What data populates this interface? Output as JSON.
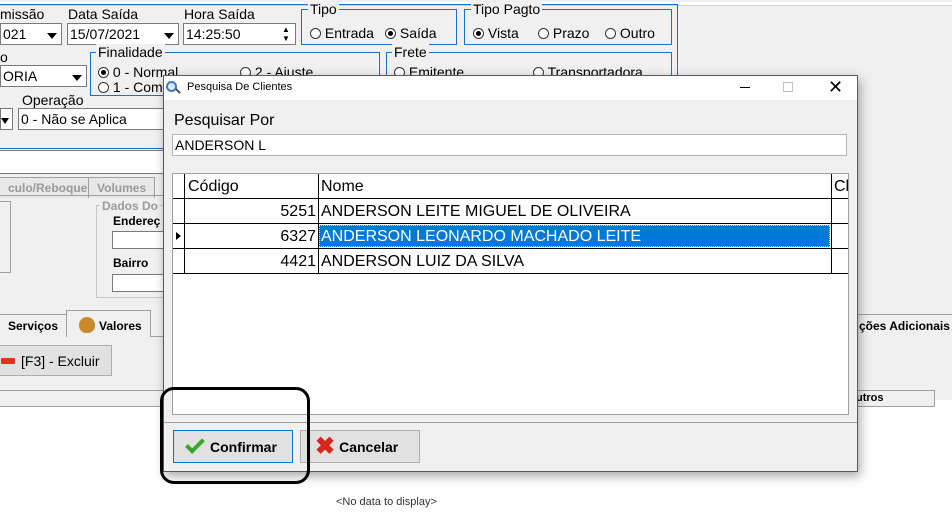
{
  "form": {
    "emissao_label": "missão",
    "emissao_value": "021",
    "data_saida_label": "Data Saída",
    "data_saida_value": "15/07/2021",
    "hora_saida_label": "Hora Saída",
    "hora_saida_value": "14:25:50",
    "tipo_title": "Tipo",
    "tipo_entrada": "Entrada",
    "tipo_saida": "Saída",
    "tipo_pagto_title": "Tipo Pagto",
    "pagto_vista": "Vista",
    "pagto_prazo": "Prazo",
    "pagto_outro": "Outro",
    "left_partial_label": "o",
    "left_combo_value": "ORIA",
    "finalidade_title": "Finalidade",
    "finalidade_1": "0 - Normal",
    "finalidade_2": "1 - Com",
    "finalidade_3": "2 - Ajuste",
    "frete_title": "Frete",
    "frete_1": "Emitente",
    "frete_2": "Transportadora",
    "operacao_label": "Operação",
    "operacao_value": "0 - Não se Aplica"
  },
  "tabs_top": {
    "veiculo": "culo/Reboque",
    "volumes": "Volumes"
  },
  "dados": {
    "title": "Dados Do",
    "endereco": "Endereç",
    "bairro": "Bairro"
  },
  "tabs_bottom": {
    "servicos": "Serviços",
    "valores": "Valores",
    "info_adicionais": "ções Adicionais"
  },
  "toolbar": {
    "excluir": "[F3] - Excluir"
  },
  "grid_bottom": {
    "outros": "utros",
    "no_data": "<No data to display>"
  },
  "dialog": {
    "title": "Pesquisa De Clientes",
    "search_label": "Pesquisar Por",
    "search_value": "ANDERSON L",
    "columns": [
      "Código",
      "Nome",
      "Cl"
    ],
    "rows": [
      {
        "codigo": "5251",
        "nome": "ANDERSON LEITE MIGUEL DE OLIVEIRA"
      },
      {
        "codigo": "6327",
        "nome": "ANDERSON LEONARDO MACHADO LEITE"
      },
      {
        "codigo": "4421",
        "nome": "ANDERSON LUIZ DA SILVA"
      }
    ],
    "confirm_label": "Confirmar",
    "cancel_label": "Cancelar"
  },
  "colors": {
    "selection": "#0078d7",
    "group_border": "#1a6fd0",
    "annotation": "#000000"
  }
}
